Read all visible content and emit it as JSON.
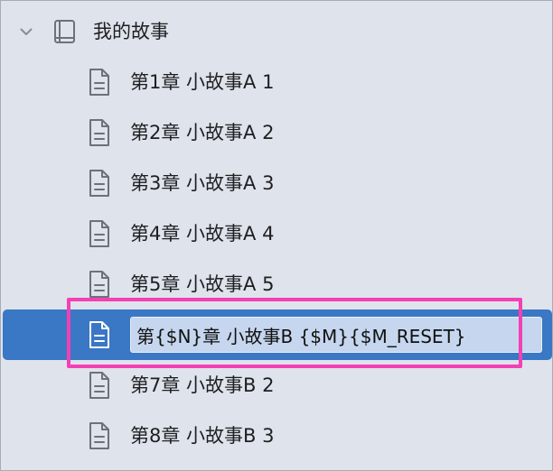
{
  "tree": {
    "root": {
      "label": "我的故事",
      "icon": "book-icon",
      "expand_icon": "chevron-down-icon"
    },
    "items": [
      {
        "label": "第1章 小故事A 1",
        "icon": "document-icon"
      },
      {
        "label": "第2章 小故事A 2",
        "icon": "document-icon"
      },
      {
        "label": "第3章 小故事A 3",
        "icon": "document-icon"
      },
      {
        "label": "第4章 小故事A 4",
        "icon": "document-icon"
      },
      {
        "label": "第5章 小故事A 5",
        "icon": "document-icon"
      },
      {
        "label": "第{$N}章 小故事B {$M}{$M_RESET}",
        "icon": "document-icon",
        "selected": true,
        "editing": true
      },
      {
        "label": "第7章 小故事B 2",
        "icon": "document-icon"
      },
      {
        "label": "第8章 小故事B 3",
        "icon": "document-icon"
      }
    ]
  },
  "colors": {
    "panel_background": "#dee3ec",
    "selection": "#3a77c4",
    "edit_field": "#c5d6ee",
    "annotation_highlight": "#f53fb4"
  }
}
